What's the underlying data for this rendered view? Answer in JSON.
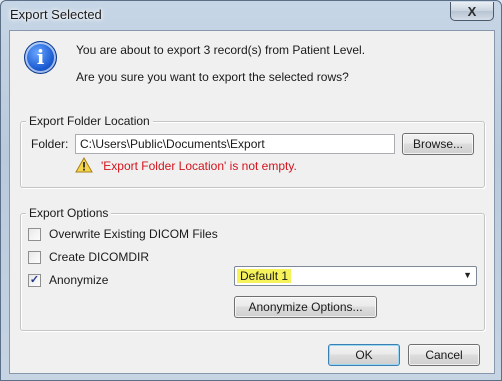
{
  "window": {
    "title": "Export Selected",
    "close_label": "X"
  },
  "message": {
    "line1": "You are about to export 3 record(s) from Patient Level.",
    "line2": "Are you sure you want to export the selected rows?"
  },
  "folder_group": {
    "title": "Export Folder Location",
    "folder_label": "Folder:",
    "folder_value": "C:\\Users\\Public\\Documents\\Export",
    "browse_label": "Browse...",
    "warning": "'Export Folder Location' is not empty."
  },
  "options_group": {
    "title": "Export Options",
    "overwrite": {
      "label": "Overwrite Existing DICOM Files",
      "checked": false
    },
    "dicomdir": {
      "label": "Create DICOMDIR",
      "checked": false
    },
    "anonymize": {
      "label": "Anonymize",
      "checked": true
    },
    "profile_selected": "Default 1",
    "anonymize_options_label": "Anonymize Options..."
  },
  "footer": {
    "ok_label": "OK",
    "cancel_label": "Cancel"
  },
  "icons": {
    "info": "info-icon",
    "warning": "warning-icon",
    "close": "close-icon",
    "dropdown": "chevron-down-icon",
    "check": "check-icon"
  },
  "colors": {
    "warning_text": "#d2141c",
    "highlight": "#f6f35a"
  }
}
